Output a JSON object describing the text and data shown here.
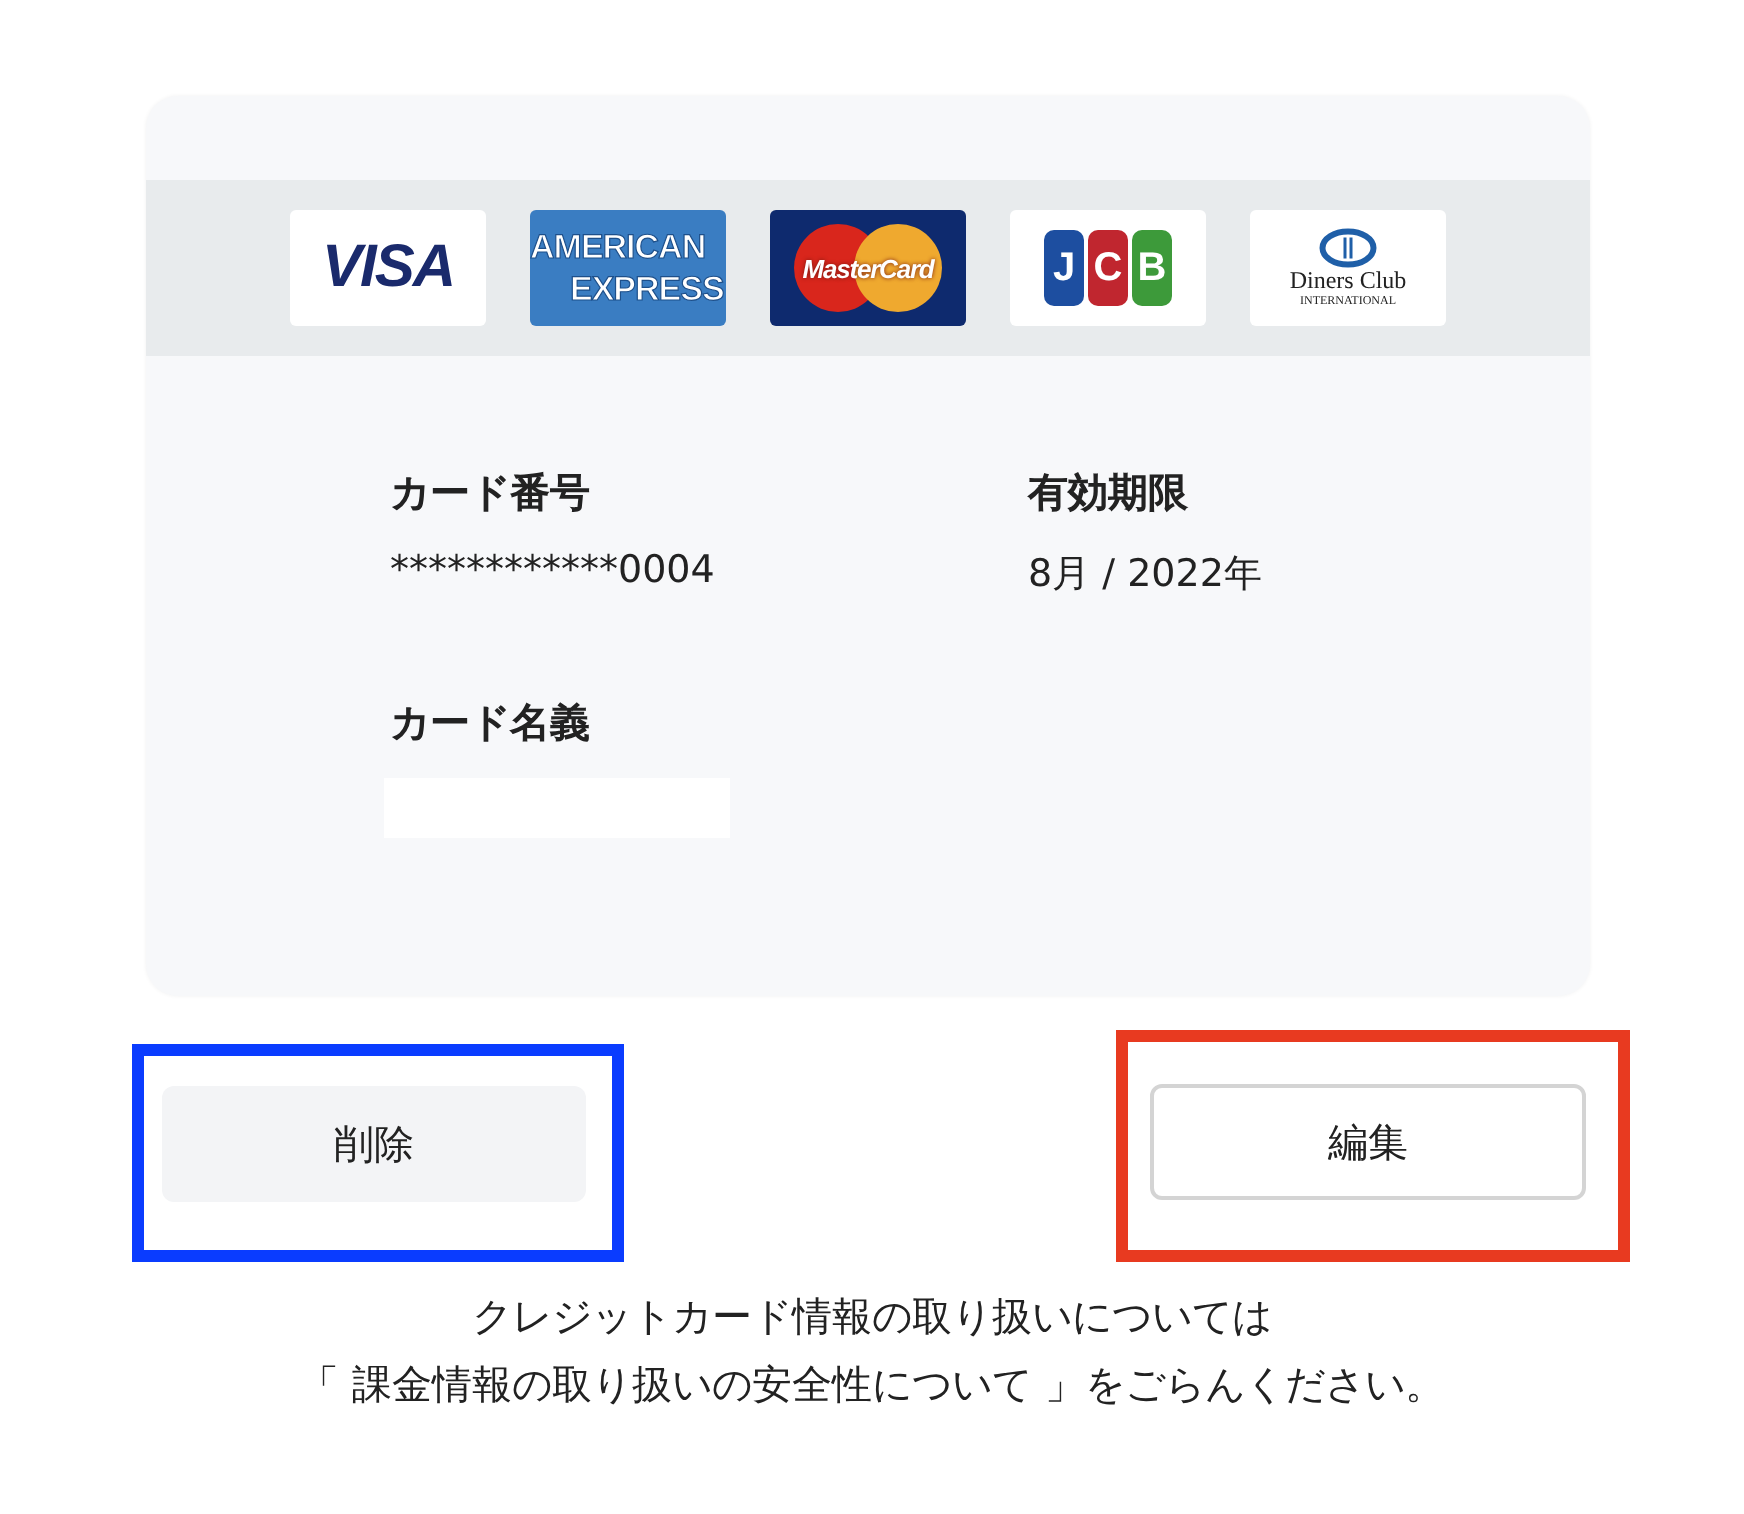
{
  "brands": [
    {
      "kind": "visa",
      "lines": [
        "VISA"
      ]
    },
    {
      "kind": "amex",
      "lines": [
        "AMERICAN",
        "EXPRESS"
      ]
    },
    {
      "kind": "mastercard",
      "lines": [
        "MasterCard"
      ]
    },
    {
      "kind": "jcb",
      "lines": [
        "J",
        "C",
        "B"
      ]
    },
    {
      "kind": "diners",
      "lines": [
        "Diners Club",
        "INTERNATIONAL"
      ]
    }
  ],
  "fields": [
    {
      "label": "カード番号",
      "value": "************0004"
    },
    {
      "label": "有効期限",
      "value": "8月 / 2022年"
    },
    {
      "label": "カード名義",
      "redacted": true
    }
  ],
  "buttons": [
    {
      "label": "削除",
      "kind": "secondary",
      "color": "#0a3cff"
    },
    {
      "label": "編集",
      "kind": "outline",
      "color": "#e83a20"
    }
  ],
  "notice": [
    "クレジットカード情報の取り扱いについては",
    "「 課金情報の取り扱いの安全性について 」をごらんください。"
  ]
}
